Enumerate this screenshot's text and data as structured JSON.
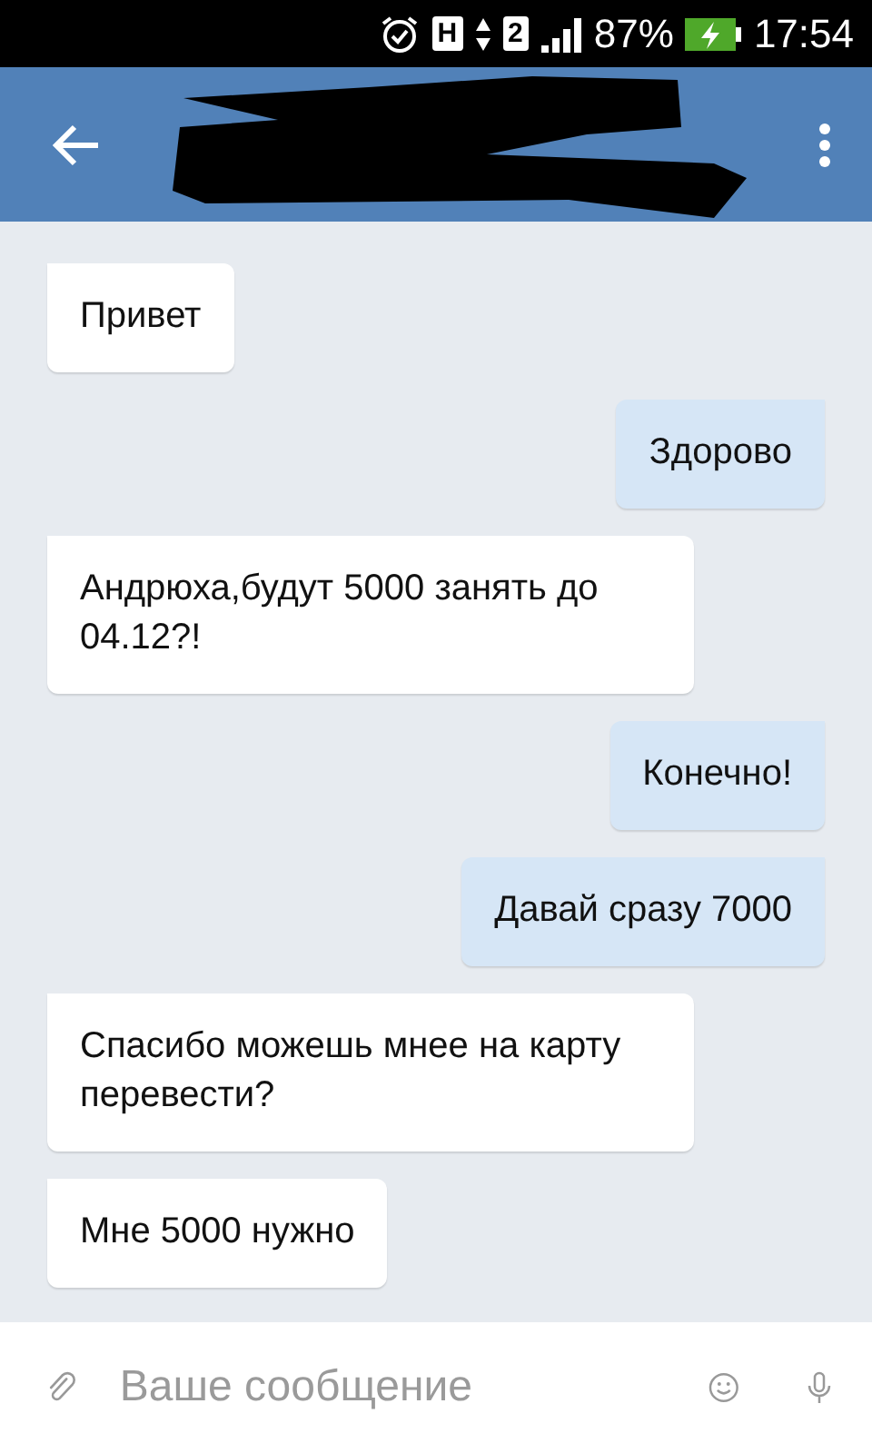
{
  "status_bar": {
    "network_type": "H",
    "sim": "2",
    "battery": "87%",
    "time": "17:54"
  },
  "input": {
    "placeholder": "Ваше сообщение"
  },
  "messages": [
    {
      "kind": "incoming",
      "text": "Привет"
    },
    {
      "kind": "outgoing",
      "text": "Здорово"
    },
    {
      "kind": "incoming",
      "text": "Андрюха,будут 5000 занять до 04.12?!"
    },
    {
      "kind": "outgoing",
      "text": "Конечно!"
    },
    {
      "kind": "outgoing",
      "text": "Давай сразу 7000"
    },
    {
      "kind": "incoming",
      "text": "Спасибо можешь мнее на карту перевести?"
    },
    {
      "kind": "incoming",
      "text": "Мне 5000 нужно"
    }
  ]
}
